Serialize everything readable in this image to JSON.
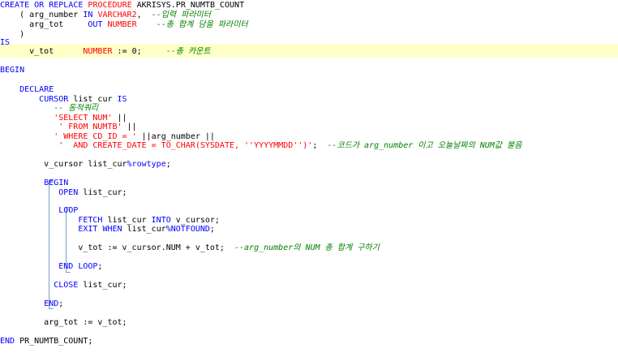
{
  "code": {
    "line1": {
      "create": "CREATE",
      "or": "OR",
      "replace": "REPLACE",
      "procedure": "PROCEDURE",
      "name": "AKRISYS.PR_NUMTB_COUNT"
    },
    "line2": {
      "indent": "    ( arg_number ",
      "in": "IN",
      "type": "VARCHAR2",
      "sep": ",  ",
      "comment": "--입력 파라미터"
    },
    "line3": {
      "indent": "      arg_tot     ",
      "out": "OUT",
      "type": "NUMBER",
      "sep": "    ",
      "comment": "--총 합계 담을 파라미터"
    },
    "line4": {
      "text": "    )"
    },
    "line5": {
      "is": "IS"
    },
    "line6": {
      "indent": "      v_tot      ",
      "type": "NUMBER",
      "assign": " := 0;     ",
      "comment": "--총 카운트"
    },
    "line7": {
      "begin": "BEGIN"
    },
    "line8": {
      "indent": "    ",
      "declare": "DECLARE"
    },
    "line9": {
      "indent": "        ",
      "cursor": "CURSOR",
      "name": " list_cur ",
      "is": "IS"
    },
    "line10": {
      "indent": "           ",
      "comment": "-- 동적쿼리"
    },
    "line11": {
      "indent": "           ",
      "str": "'SELECT NUM'",
      "rest": " ||"
    },
    "line12": {
      "indent": "            ",
      "str": "' FROM NUMTB'",
      "rest": " ||"
    },
    "line13": {
      "indent": "           ",
      "str": "' WHERE CD_ID = '",
      "rest": " ||arg_number ||"
    },
    "line14": {
      "indent": "            ",
      "str": "'  AND CREATE_DATE = TO_CHAR(SYSDATE, ''YYYYMMDD'')'",
      "rest": ";  ",
      "comment": "--코드가 arg_number 이고 오늘날짜의 NUM값 불음"
    },
    "line15": {
      "indent": "         v_cursor list_cur",
      "attr": "%rowtype",
      "rest": ";"
    },
    "line16": {
      "indent": "         ",
      "begin": "BEGIN"
    },
    "line17": {
      "indent": "            ",
      "open": "OPEN",
      "rest": " list_cur;"
    },
    "line18": {
      "indent": "            ",
      "loop": "LOOP"
    },
    "line19": {
      "indent": "                ",
      "fetch": "FETCH",
      "rest1": " list_cur ",
      "into": "INTO",
      "rest2": " v_cursor;"
    },
    "line20": {
      "indent": "                ",
      "exit": "EXIT",
      "sp": " ",
      "when": "WHEN",
      "rest": " list_cur",
      "attr": "%NOTFOUND",
      "end": ";"
    },
    "line21": {
      "indent": "                v_tot := v_cursor.NUM + v_tot;  ",
      "comment": "--arg_number의 NUM 총 합계 구하기"
    },
    "line22": {
      "indent": "            ",
      "endloop": "END LOOP",
      "rest": ";"
    },
    "line23": {
      "indent": "           ",
      "close": "CLOSE",
      "rest": " list_cur;"
    },
    "line24": {
      "indent": "         ",
      "end": "END",
      "rest": ";"
    },
    "line25": {
      "text": "         arg_tot := v_tot;"
    },
    "line26": {
      "end": "END",
      "rest": " PR_NUMTB_COUNT;"
    }
  }
}
